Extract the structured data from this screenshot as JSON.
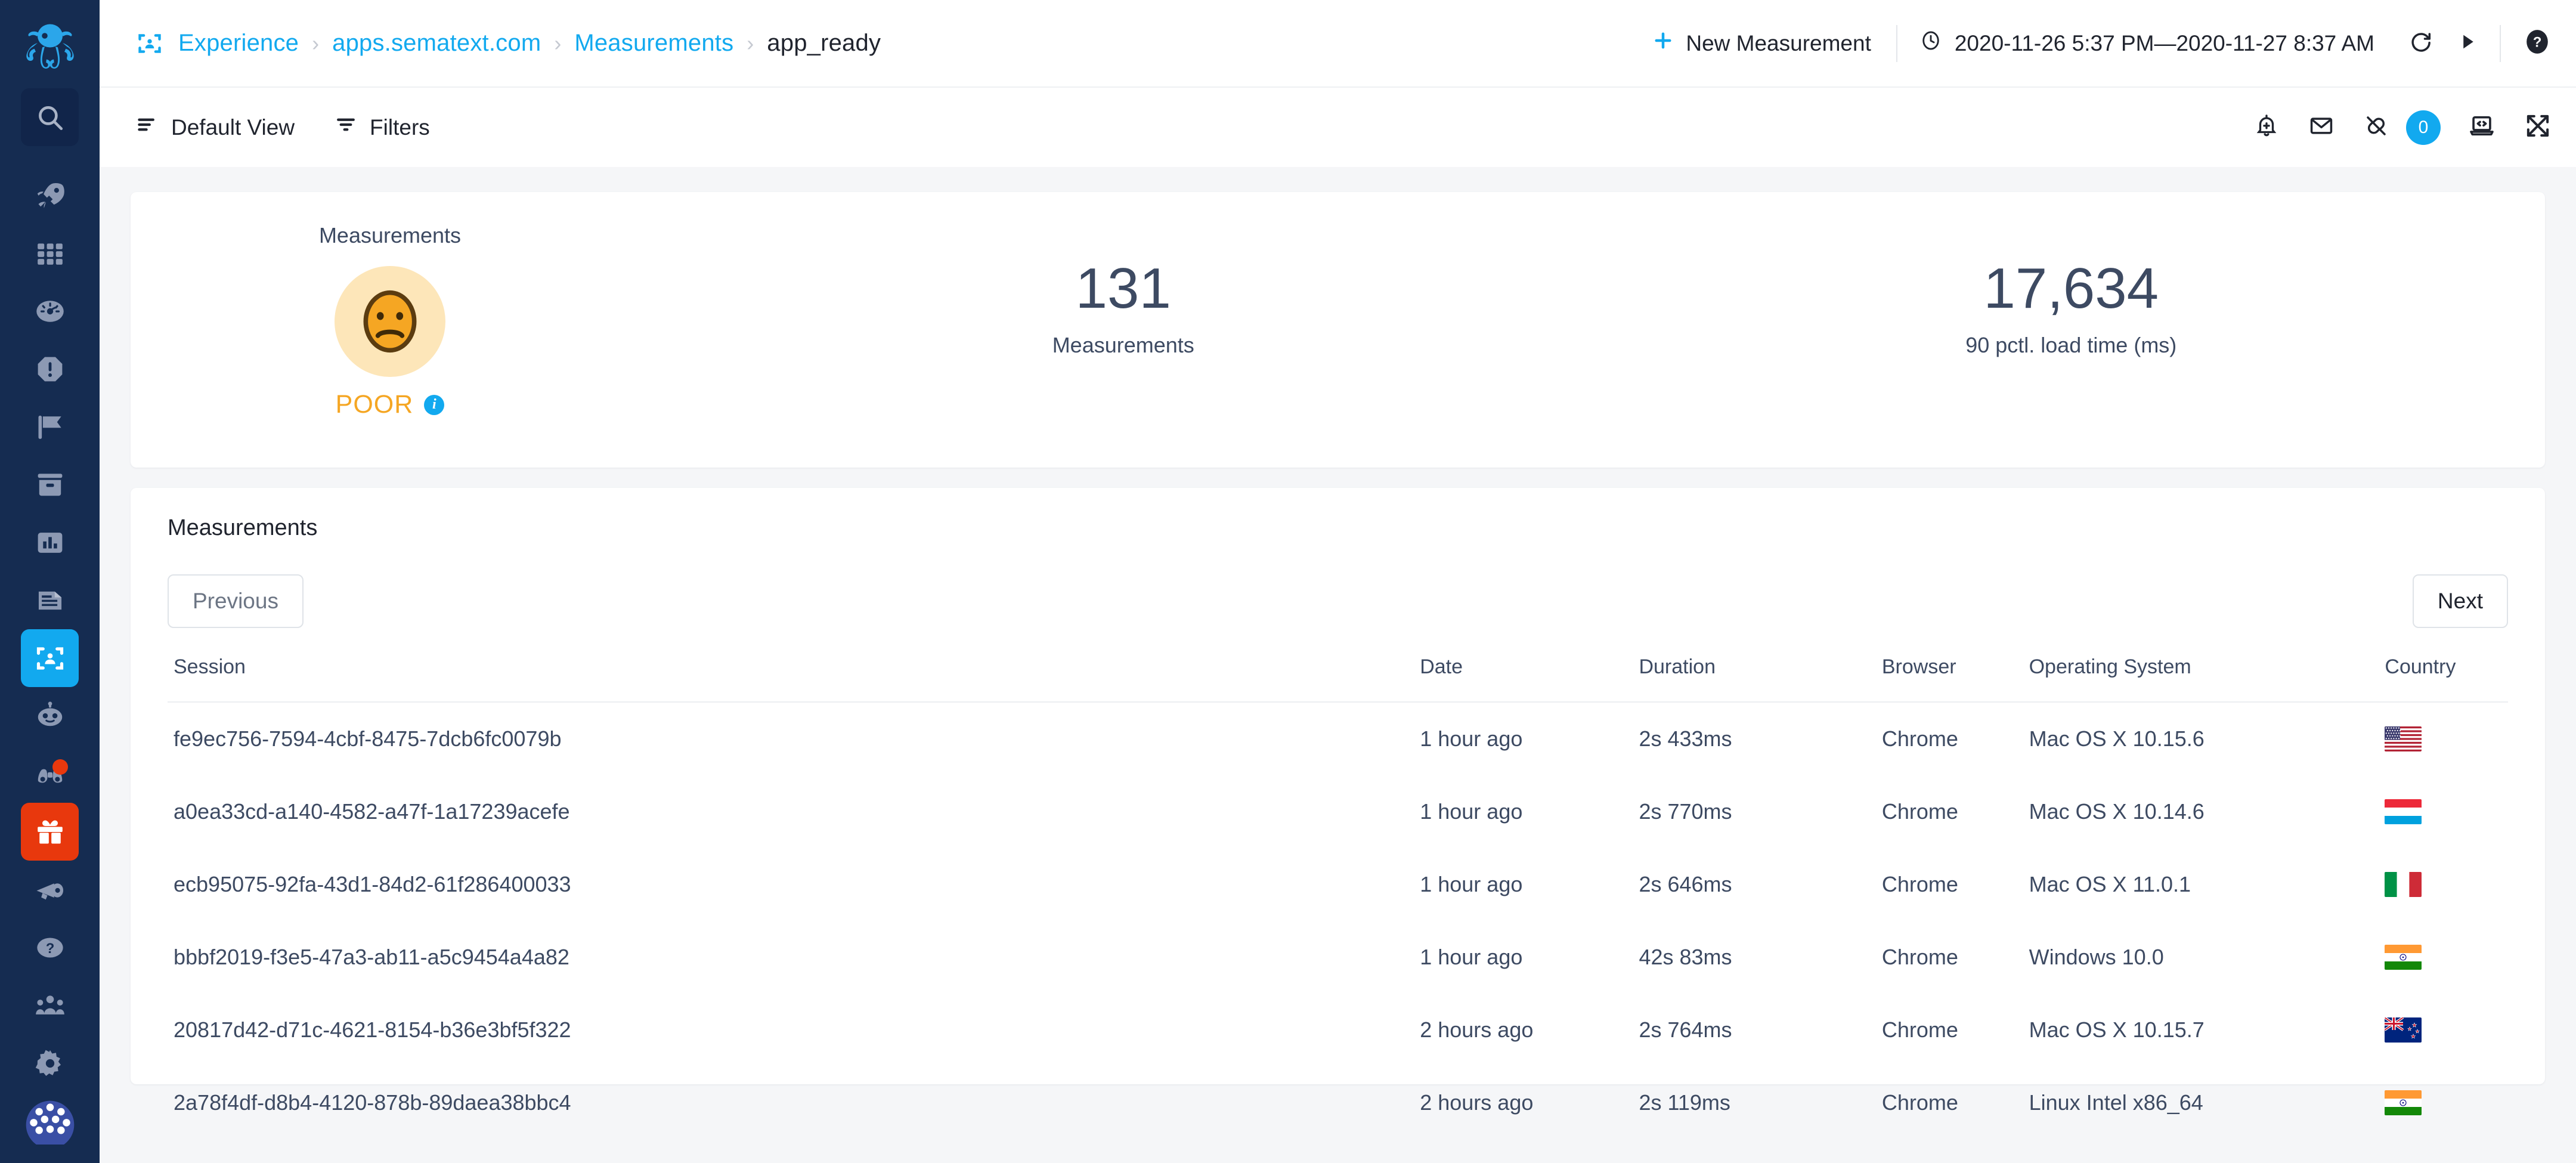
{
  "sidebar": {
    "logo": "octopus-logo",
    "items": [
      {
        "name": "search",
        "icon": "search-icon",
        "state": "box"
      },
      {
        "name": "onboarding",
        "icon": "rocket-icon",
        "state": "normal"
      },
      {
        "name": "apps",
        "icon": "grid-icon",
        "state": "normal"
      },
      {
        "name": "monitoring",
        "icon": "gauge-icon",
        "state": "normal"
      },
      {
        "name": "alerts",
        "icon": "alert-octagon-icon",
        "state": "normal"
      },
      {
        "name": "events",
        "icon": "flag-icon",
        "state": "normal"
      },
      {
        "name": "inventory",
        "icon": "archive-icon",
        "state": "normal"
      },
      {
        "name": "reports",
        "icon": "bar-chart-icon",
        "state": "normal"
      },
      {
        "name": "logs",
        "icon": "document-icon",
        "state": "normal"
      },
      {
        "name": "experience",
        "icon": "experience-icon",
        "state": "active"
      },
      {
        "name": "synthetics",
        "icon": "robot-icon",
        "state": "normal"
      },
      {
        "name": "bot",
        "icon": "binoculars-icon",
        "state": "badge"
      },
      {
        "name": "gift",
        "icon": "gift-icon",
        "state": "gift"
      },
      {
        "name": "announcements",
        "icon": "megaphone-icon",
        "state": "normal"
      },
      {
        "name": "help",
        "icon": "question-circle-icon",
        "state": "normal"
      },
      {
        "name": "team",
        "icon": "team-icon",
        "state": "normal"
      },
      {
        "name": "settings",
        "icon": "gear-icon",
        "state": "normal"
      },
      {
        "name": "globe",
        "icon": "globe-icon",
        "state": "normal"
      }
    ]
  },
  "topbar": {
    "breadcrumb_icon": "experience-icon",
    "breadcrumbs": [
      {
        "label": "Experience",
        "active": true
      },
      {
        "label": "apps.sematext.com",
        "active": true
      },
      {
        "label": "Measurements",
        "active": true
      },
      {
        "label": "app_ready",
        "active": false
      }
    ],
    "separator": "›",
    "new_measurement_label": "New Measurement",
    "plus_icon": "plus-icon",
    "clock_icon": "clock-icon",
    "time_range": "2020-11-26 5:37 PM—2020-11-27 8:37 AM",
    "refresh_icon": "refresh-icon",
    "play_icon": "play-icon",
    "help_icon": "help-circle-icon"
  },
  "toolbar": {
    "view_label": "Default View",
    "view_icon": "list-icon",
    "filters_label": "Filters",
    "filters_icon": "filter-icon",
    "right_icons": [
      {
        "name": "bell-plus-icon"
      },
      {
        "name": "envelope-icon"
      },
      {
        "name": "plug-off-icon"
      }
    ],
    "badge_count": "0",
    "badge_color": "#12a9ef",
    "laptop_code_icon": "laptop-code-icon",
    "fullscreen_icon": "fullscreen-icon"
  },
  "summary": {
    "title": "Measurements",
    "face_icon": "frowning-face-icon",
    "rating": "POOR",
    "rating_color": "#f5a623",
    "info_icon": "info-icon",
    "kpis": [
      {
        "value": "131",
        "label": "Measurements"
      },
      {
        "value": "17,634",
        "label": "90 pctl. load time (ms)"
      }
    ]
  },
  "table_section": {
    "heading": "Measurements",
    "previous_label": "Previous",
    "next_label": "Next",
    "columns": [
      "Session",
      "Date",
      "Duration",
      "Browser",
      "Operating System",
      "Country"
    ],
    "rows": [
      {
        "session": "fe9ec756-7594-4cbf-8475-7dcb6fc0079b",
        "date": "1 hour ago",
        "duration": "2s 433ms",
        "browser": "Chrome",
        "os": "Mac OS X 10.15.6",
        "country": "us"
      },
      {
        "session": "a0ea33cd-a140-4582-a47f-1a17239acefe",
        "date": "1 hour ago",
        "duration": "2s 770ms",
        "browser": "Chrome",
        "os": "Mac OS X 10.14.6",
        "country": "lu"
      },
      {
        "session": "ecb95075-92fa-43d1-84d2-61f286400033",
        "date": "1 hour ago",
        "duration": "2s 646ms",
        "browser": "Chrome",
        "os": "Mac OS X 11.0.1",
        "country": "it"
      },
      {
        "session": "bbbf2019-f3e5-47a3-ab11-a5c9454a4a82",
        "date": "1 hour ago",
        "duration": "42s 83ms",
        "browser": "Chrome",
        "os": "Windows 10.0",
        "country": "in"
      },
      {
        "session": "20817d42-d71c-4621-8154-b36e3bf5f322",
        "date": "2 hours ago",
        "duration": "2s 764ms",
        "browser": "Chrome",
        "os": "Mac OS X 10.15.7",
        "country": "nz"
      },
      {
        "session": "2a78f4df-d8b4-4120-878b-89daea38bbc4",
        "date": "2 hours ago",
        "duration": "2s 119ms",
        "browser": "Chrome",
        "os": "Linux Intel x86_64",
        "country": "in"
      }
    ]
  }
}
